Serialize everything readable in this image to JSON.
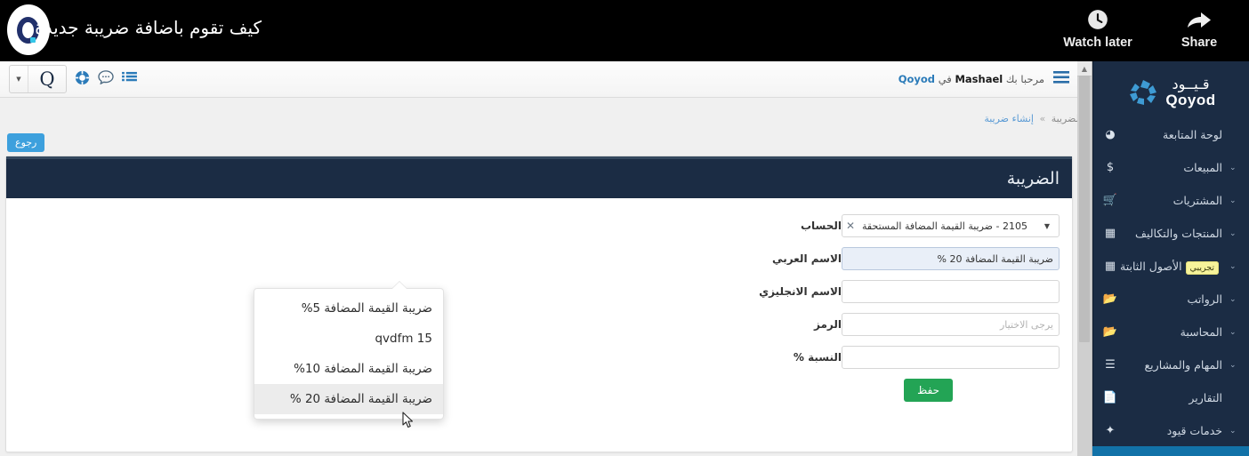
{
  "video_overlay": {
    "title": "كيف تقوم باضافة ضريبة جديدة",
    "logo_icon": "qoyod-circle-logo",
    "actions": [
      {
        "label": "Watch later",
        "icon": "clock-icon"
      },
      {
        "label": "Share",
        "icon": "share-arrow-icon"
      }
    ]
  },
  "sidebar": {
    "brand_ar": "قـيــود",
    "brand_en": "Qoyod",
    "brand_icon": "qoyod-pinwheel-logo",
    "items": [
      {
        "label": "لوحة المتابعة",
        "icon": "dashboard-icon",
        "caret": "",
        "badge": ""
      },
      {
        "label": "المبيعات",
        "icon": "dollar-icon",
        "caret": "⌄",
        "badge": ""
      },
      {
        "label": "المشتريات",
        "icon": "cart-icon",
        "caret": "⌄",
        "badge": ""
      },
      {
        "label": "المنتجات والتكاليف",
        "icon": "grid-icon",
        "caret": "⌄",
        "badge": ""
      },
      {
        "label": "الأصول الثابتة",
        "icon": "grid-icon",
        "caret": "⌄",
        "badge": "تجريبي"
      },
      {
        "label": "الرواتب",
        "icon": "folder-icon",
        "caret": "⌄",
        "badge": ""
      },
      {
        "label": "المحاسبة",
        "icon": "folder-icon",
        "caret": "⌄",
        "badge": ""
      },
      {
        "label": "المهام والمشاريع",
        "icon": "list-icon",
        "caret": "⌄",
        "badge": ""
      },
      {
        "label": "التقارير",
        "icon": "document-icon",
        "caret": "",
        "badge": ""
      },
      {
        "label": "خدمات قيود",
        "icon": "services-icon",
        "caret": "⌄",
        "badge": ""
      }
    ]
  },
  "topbar": {
    "q_logo": "Q",
    "caret_icon": "chevron-down-icon",
    "icons": [
      {
        "name": "life-ring-icon",
        "glyph": "◉"
      },
      {
        "name": "chat-bubble-icon",
        "glyph": "💬"
      },
      {
        "name": "list-lines-icon",
        "glyph": "☰"
      }
    ],
    "hamburger_icon": "hamburger-menu-icon",
    "welcome_prefix": "مرحبا بك",
    "welcome_user": "Mashael",
    "welcome_mid": "في",
    "welcome_brand": "Qoyod"
  },
  "breadcrumb": {
    "parent": "الضريبة",
    "separator": "»",
    "current": "إنشاء ضريبة"
  },
  "back_button": {
    "label": "رجوع"
  },
  "panel": {
    "title": "الضريبة",
    "fields": [
      {
        "label": "الحساب",
        "type": "select",
        "value": "2105 - ضريبة القيمة المضافة المستحقة",
        "clear_icon": "close-x-icon",
        "arrow_icon": "chevron-down-icon"
      },
      {
        "label": "الاسم العربي",
        "type": "text",
        "value": "ضريبة القيمة المضافة 20 %",
        "placeholder": "",
        "focused": true
      },
      {
        "label": "الاسم الانجليزي",
        "type": "text",
        "value": "",
        "placeholder": "",
        "focused": false
      },
      {
        "label": "الرمز",
        "type": "text",
        "value": "",
        "placeholder": "يرجى الاختيار",
        "focused": false
      },
      {
        "label": "النسبة %",
        "type": "text",
        "value": "",
        "placeholder": "",
        "focused": false
      }
    ],
    "save_label": "حفظ"
  },
  "autocomplete": {
    "options": [
      {
        "text": "ضريبة القيمة المضافة 5%",
        "active": false
      },
      {
        "text": "qvdfm 15",
        "active": false
      },
      {
        "text": "ضريبة القيمة المضافة 10%",
        "active": false
      },
      {
        "text": "ضريبة القيمة المضافة 20 %",
        "active": true
      }
    ]
  },
  "colors": {
    "sidebar_bg": "#1b2c44",
    "sidebar_bottom": "#1272a8",
    "panel_header": "#1b2c44",
    "save_green": "#23a455",
    "link_blue": "#2b7bb9",
    "back_blue": "#3da0dd",
    "badge_yellow": "#f6f39a"
  }
}
